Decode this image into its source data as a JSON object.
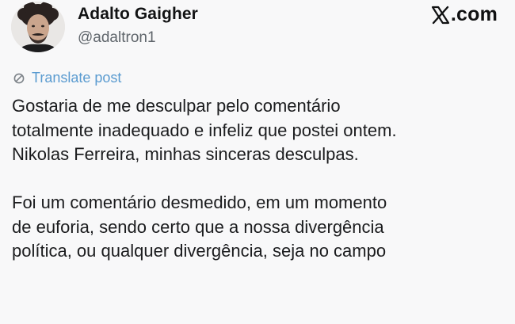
{
  "author": {
    "display_name": "Adalto Gaigher",
    "handle": "@adaltron1",
    "avatar_icon": "profile-photo"
  },
  "site": {
    "logo_icon": "x-logo-icon",
    "domain_suffix": ".com"
  },
  "translate": {
    "icon": "globe-translate-icon",
    "label": "Translate post",
    "color": "#5a9bd0"
  },
  "post": {
    "paragraphs": [
      {
        "lines": [
          "Gostaria de me desculpar pelo comentário",
          "totalmente inadequado e infeliz que postei ontem.",
          "Nikolas Ferreira, minhas sinceras desculpas."
        ]
      },
      {
        "lines": [
          "Foi um comentário desmedido, em um momento",
          "de euforia, sendo certo que a nossa divergência",
          "política, ou qualquer divergência, seja no campo"
        ]
      }
    ]
  }
}
